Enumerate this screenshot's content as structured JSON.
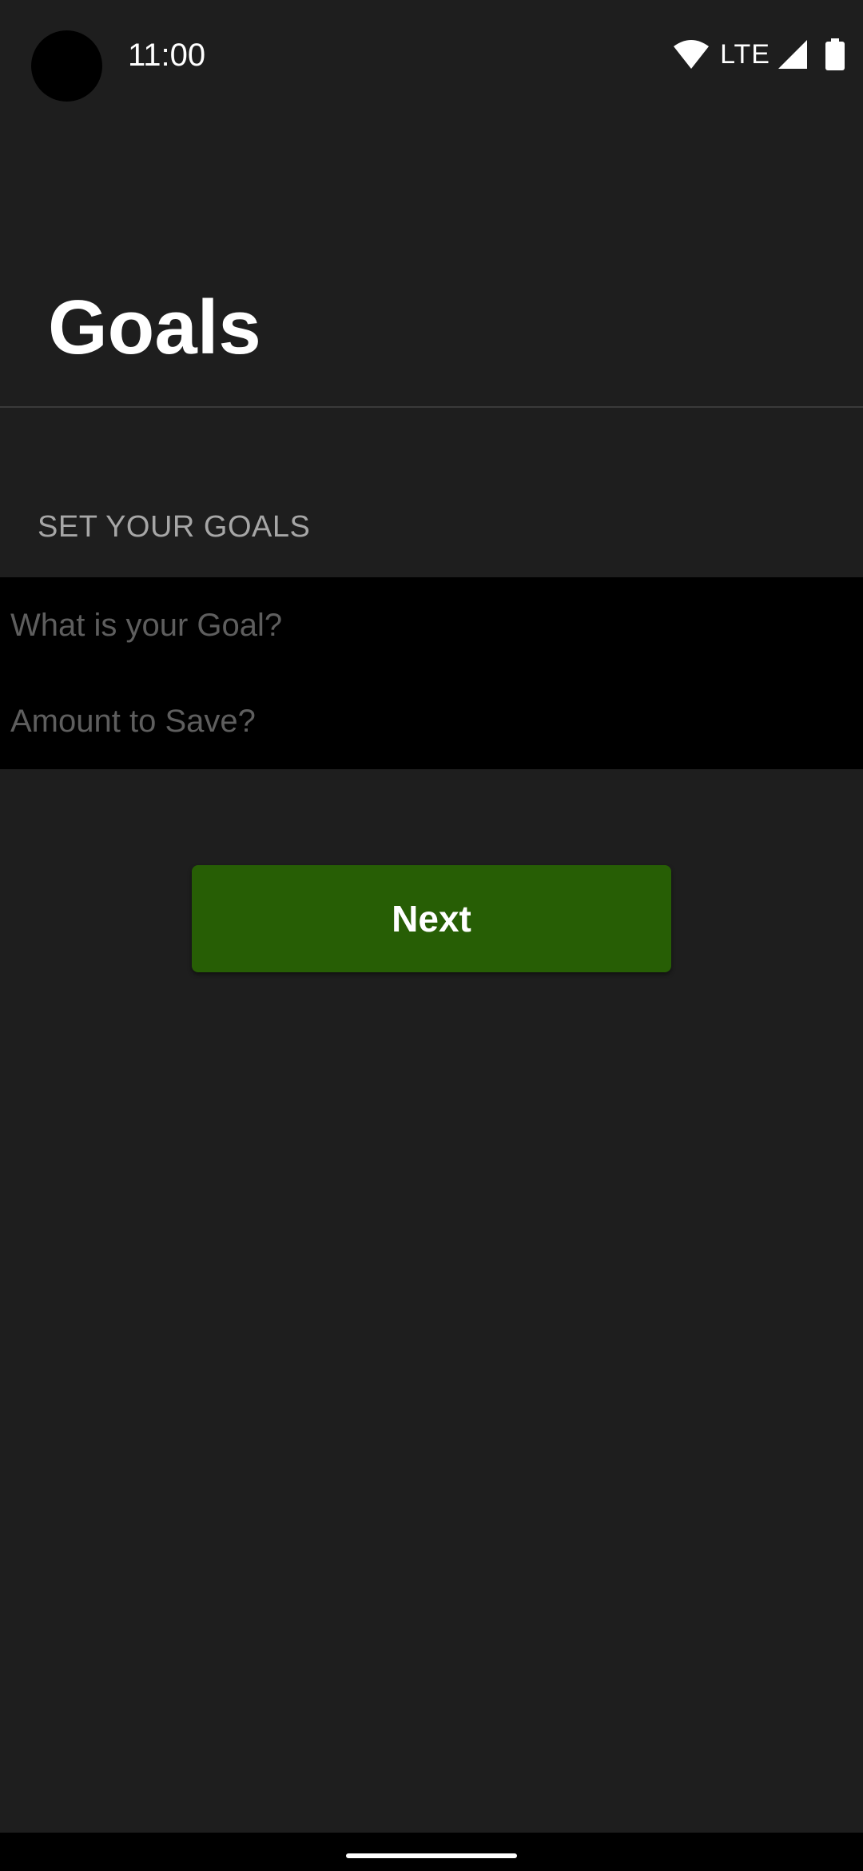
{
  "status_bar": {
    "time": "11:00",
    "network_label": "LTE",
    "icons": [
      "camera-cutout",
      "wifi-icon",
      "signal-icon",
      "battery-icon"
    ]
  },
  "header": {
    "title": "Goals"
  },
  "goals_section": {
    "header": "SET YOUR GOALS",
    "goal_field": {
      "value": "",
      "placeholder": "What is your Goal?"
    },
    "amount_field": {
      "value": "",
      "placeholder": "Amount to Save?"
    }
  },
  "actions": {
    "next_label": "Next"
  },
  "colors": {
    "background": "#1e1e1e",
    "form_background": "#000000",
    "accent_button": "#275e05",
    "title_text": "#ffffff",
    "section_header_text": "#a6a6a6",
    "placeholder_text": "#5e5e5e"
  }
}
